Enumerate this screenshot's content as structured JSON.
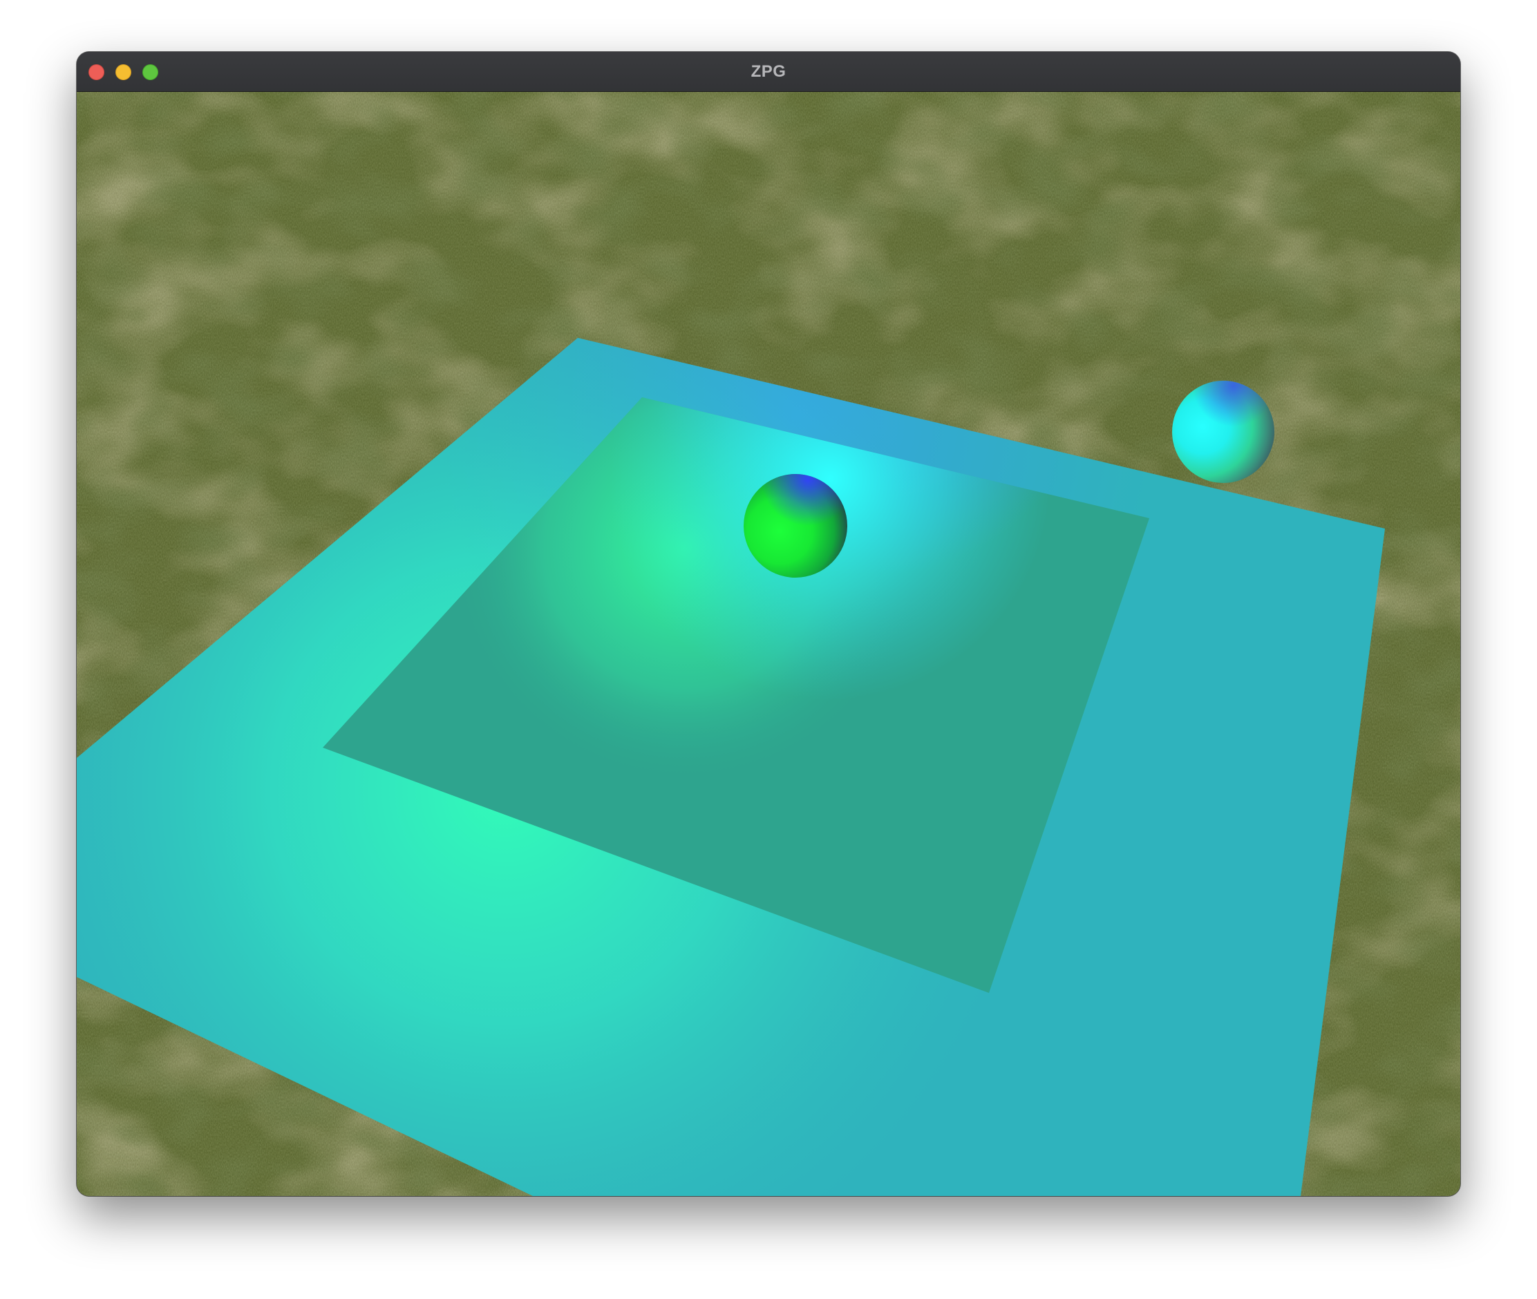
{
  "window": {
    "title": "ZPG",
    "controls": [
      "close",
      "minimize",
      "zoom"
    ]
  },
  "scene": {
    "background": "grass-texture",
    "objects": [
      "ground-plane",
      "inner-square",
      "green-sphere",
      "cyan-sphere"
    ]
  },
  "colors": {
    "plane": "#2fc3b8",
    "inner_square": "#2ea98f",
    "spot_light": "#33ffb0",
    "sphere_green": "#19ef35",
    "sphere_cyan": "#22f0ef",
    "sphere_blue_tint": "#3a5cf0"
  }
}
